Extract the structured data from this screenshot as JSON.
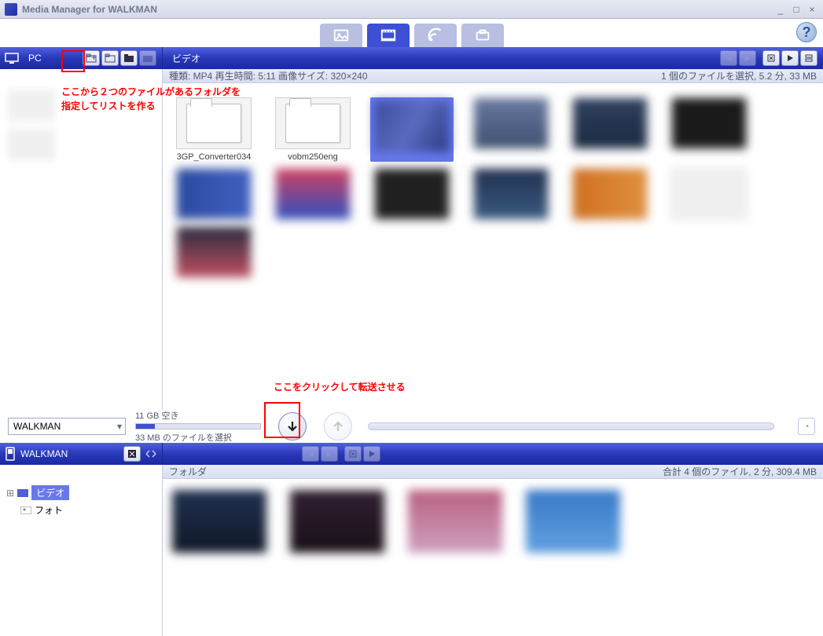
{
  "window": {
    "title": "Media Manager for WALKMAN",
    "minimize": "_",
    "maximize": "□",
    "close": "×"
  },
  "toptabs": {
    "photo": "photo",
    "video": "video",
    "podcast": "podcast",
    "tools": "tools"
  },
  "help": "?",
  "pc_bar": {
    "label": "PC"
  },
  "video_bar": {
    "label": "ビデオ"
  },
  "infostrip": {
    "left": "種類: MP4  再生時間: 5:11  画像サイズ: 320×240",
    "right": "1 個のファイルを選択, 5.2 分, 33 MB"
  },
  "folders": {
    "f1": "3GP_Converter034",
    "f2": "vobm250eng"
  },
  "annotation": {
    "top1": "ここから２つのファイルがあるフォルダを",
    "top2": "指定してリストを作る",
    "mid": "ここをクリックして転送させる"
  },
  "transfer": {
    "device": "WALKMAN",
    "free": "11 GB 空き",
    "selected": "33 MB のファイルを選択"
  },
  "walkman_bar": {
    "label": "WALKMAN"
  },
  "lower_info": {
    "left": "フォルダ",
    "right": "合計 4 個のファイル, 2 分, 309.4 MB"
  },
  "tree": {
    "video": "ビデオ",
    "photo": "フォト"
  }
}
